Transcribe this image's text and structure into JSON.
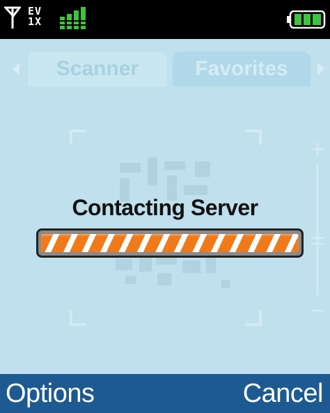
{
  "status_bar": {
    "network_top": "EV",
    "network_bottom": "1X",
    "signal_icon": "signal-bars-icon",
    "battery_icon": "battery-icon",
    "antenna_icon": "antenna-icon"
  },
  "tabs": [
    {
      "label": "Scanner",
      "selected": true
    },
    {
      "label": "Favorites",
      "selected": false
    }
  ],
  "dialog": {
    "title": "Contacting Server",
    "progress": 1.0
  },
  "softkeys": {
    "left": "Options",
    "right": "Cancel"
  },
  "colors": {
    "background": "#bfe0ec",
    "softkey_bar": "#1d5a91",
    "progress_orange": "#f07a1a",
    "battery_green": "#3ec43e"
  }
}
